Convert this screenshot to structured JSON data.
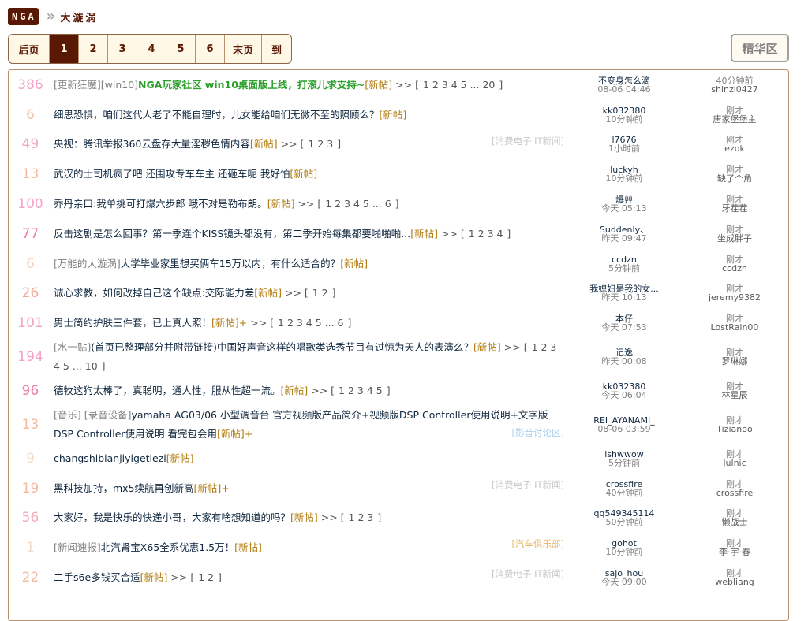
{
  "header": {
    "logo": "NGA",
    "separator": "»",
    "forum": "大漩涡"
  },
  "pager": {
    "prev": "后页",
    "pages": [
      "1",
      "2",
      "3",
      "4",
      "5",
      "6"
    ],
    "current": "1",
    "last": "末页",
    "goto": "到"
  },
  "elite_label": "精华区",
  "colors": {
    "brand": "#591804",
    "new": "#b0790a",
    "highlight": "#2a9f2a"
  },
  "topics": [
    {
      "count": "386",
      "count_color": "#f3a3c6",
      "prefix": "[更新狂魔][win10]",
      "highlight": "NGA玩家社区 win10桌面版上线，打滚儿求支持~",
      "title": "",
      "new": "[新帖]",
      "plus": "",
      "pages": "1 2 3 4 5 ... 20",
      "category": "",
      "cat_style": "",
      "author": "不变身怎么滴",
      "post_time": "08-06 04:46",
      "last_time": "40分钟前",
      "last_user": "shinzi0427",
      "tall": false
    },
    {
      "count": "6",
      "count_color": "#f0c5a8",
      "prefix": "",
      "highlight": "",
      "title": "细思恐惧，咱们这代人老了不能自理时，儿女能给咱们无微不至的照顾么？",
      "new": "[新帖]",
      "plus": "",
      "pages": "",
      "category": "",
      "cat_style": "",
      "author": "kk032380",
      "post_time": "10分钟前",
      "last_time": "刚才",
      "last_user": "唐家堡堡主",
      "tall": false
    },
    {
      "count": "49",
      "count_color": "#f5aab9",
      "prefix": "",
      "highlight": "",
      "title": "央视：腾讯举报360云盘存大量淫秽色情内容",
      "new": "[新帖]",
      "plus": "",
      "pages": "1 2 3",
      "category": "[消费电子 IT新闻]",
      "cat_style": "",
      "author": "l7676",
      "post_time": "1小时前",
      "last_time": "刚才",
      "last_user": "ezok",
      "tall": false
    },
    {
      "count": "13",
      "count_color": "#f5b9a0",
      "prefix": "",
      "highlight": "",
      "title": "武汉的士司机疯了吧 还围攻专车车主 还砸车呢 我好怕",
      "new": "[新帖]",
      "plus": "",
      "pages": "",
      "category": "",
      "cat_style": "",
      "author": "luckyh",
      "post_time": "10分钟前",
      "last_time": "刚才",
      "last_user": "缺了个角",
      "tall": false
    },
    {
      "count": "100",
      "count_color": "#f3a3c6",
      "prefix": "",
      "highlight": "",
      "title": "乔丹亲口:我单挑可打爆六步郎 哦不对是勒布朗。",
      "new": "[新帖]",
      "plus": "",
      "pages": "1 2 3 4 5 ... 6",
      "category": "",
      "cat_style": "",
      "author": "爆艸",
      "post_time": "今天 05:13",
      "last_time": "刚才",
      "last_user": "牙茬茬",
      "tall": false
    },
    {
      "count": "77",
      "count_color": "#ef7fa0",
      "prefix": "",
      "highlight": "",
      "title": "反击这剧是怎么回事？第一季连个KISS镜头都没有，第二季开始每集都要啪啪啪...",
      "new": "[新帖]",
      "plus": "",
      "pages": "1 2 3 4",
      "category": "",
      "cat_style": "",
      "author": "Suddenly、",
      "post_time": "昨天 09:47",
      "last_time": "刚才",
      "last_user": "坐成胖子",
      "tall": false
    },
    {
      "count": "6",
      "count_color": "#f5d5c0",
      "prefix": "[万能的大漩涡]",
      "highlight": "",
      "title": "大学毕业家里想买俩车15万以内，有什么适合的？",
      "new": "[新帖]",
      "plus": "",
      "pages": "",
      "category": "",
      "cat_style": "",
      "author": "ccdzn",
      "post_time": "5分钟前",
      "last_time": "刚才",
      "last_user": "ccdzn",
      "tall": false
    },
    {
      "count": "26",
      "count_color": "#f0a890",
      "prefix": "",
      "highlight": "",
      "title": "诚心求教，如何改掉自己这个缺点:交际能力差",
      "new": "[新帖]",
      "plus": "",
      "pages": "1 2",
      "category": "",
      "cat_style": "",
      "author": "我媳妇是我的女...",
      "post_time": "昨天 10:13",
      "last_time": "刚才",
      "last_user": "jeremy9382",
      "tall": false
    },
    {
      "count": "101",
      "count_color": "#f3a3c6",
      "prefix": "",
      "highlight": "",
      "title": "男士简约护肤三件套，已上真人照！",
      "new": "[新帖]",
      "plus": "+",
      "pages": "1 2 3 4 5 ... 6",
      "category": "",
      "cat_style": "",
      "author": "本仔",
      "post_time": "今天 07:53",
      "last_time": "刚才",
      "last_user": "LostRain00",
      "tall": false
    },
    {
      "count": "194",
      "count_color": "#f3a3c6",
      "prefix": "[水一贴]",
      "highlight": "",
      "title": "(首页已整理部分并附带链接)中国好声音这样的唱歌类选秀节目有过惊为天人的表演么？",
      "new": "[新帖]",
      "plus": "",
      "pages": "1 2 3 4 5 ... 10",
      "category": "",
      "cat_style": "",
      "author": "记逸",
      "post_time": "昨天 00:08",
      "last_time": "刚才",
      "last_user": "罗琳娜",
      "tall": true
    },
    {
      "count": "96",
      "count_color": "#ef7fa0",
      "prefix": "",
      "highlight": "",
      "title": "德牧这狗太棒了，真聪明，通人性，服从性超一流。",
      "new": "[新帖]",
      "plus": "",
      "pages": "1 2 3 4 5",
      "category": "",
      "cat_style": "",
      "author": "kk032380",
      "post_time": "今天 06:04",
      "last_time": "刚才",
      "last_user": "林星辰",
      "tall": false
    },
    {
      "count": "13",
      "count_color": "#f5b9a0",
      "prefix": "[音乐] [录音设备]",
      "highlight": "",
      "title": "yamaha AG03/06 小型调音台 官方视频版产品简介+视频版DSP Controller使用说明+文字版DSP Controller使用说明 看完包会用",
      "new": "[新帖]",
      "plus": "+",
      "pages": "",
      "category": "[影音讨论区]",
      "cat_style": "blue",
      "author": "REI_AYANAMI_",
      "post_time": "08-06 03:59",
      "last_time": "刚才",
      "last_user": "Tizianoo",
      "tall": true
    },
    {
      "count": "9",
      "count_color": "#f5dcc8",
      "prefix": "",
      "highlight": "",
      "title": "changshibianjiyigetiezi",
      "new": "[新帖]",
      "plus": "",
      "pages": "",
      "category": "",
      "cat_style": "",
      "author": "lshwwow",
      "post_time": "5分钟前",
      "last_time": "刚才",
      "last_user": "Julnic",
      "tall": false
    },
    {
      "count": "19",
      "count_color": "#f5b9a0",
      "prefix": "",
      "highlight": "",
      "title": "黑科技加持，mx5续航再创新高",
      "new": "[新帖]",
      "plus": "+",
      "pages": "",
      "category": "[消费电子 IT新闻]",
      "cat_style": "",
      "author": "crossfire",
      "post_time": "40分钟前",
      "last_time": "刚才",
      "last_user": "crossfire",
      "tall": false
    },
    {
      "count": "56",
      "count_color": "#f5aab9",
      "prefix": "",
      "highlight": "",
      "title": "大家好，我是快乐的快递小哥，大家有啥想知道的吗？",
      "new": "[新帖]",
      "plus": "",
      "pages": "1 2 3",
      "category": "",
      "cat_style": "",
      "author": "qq549345114",
      "post_time": "50分钟前",
      "last_time": "刚才",
      "last_user": "懒战士",
      "tall": false
    },
    {
      "count": "1",
      "count_color": "#f5dcc8",
      "prefix": "[新闻速报]",
      "highlight": "",
      "title": "北汽肾宝X65全系优惠1.5万！",
      "new": "[新帖]",
      "plus": "",
      "pages": "",
      "category": "[汽车俱乐部]",
      "cat_style": "orange",
      "author": "gohot",
      "post_time": "10分钟前",
      "last_time": "刚才",
      "last_user": "李·宇·春",
      "tall": false
    },
    {
      "count": "22",
      "count_color": "#f5b9a0",
      "prefix": "",
      "highlight": "",
      "title": "二手s6e多钱买合适",
      "new": "[新帖]",
      "plus": "",
      "pages": "1 2",
      "category": "[消费电子 IT新闻]",
      "cat_style": "",
      "author": "sajo_hou",
      "post_time": "今天 09:00",
      "last_time": "刚才",
      "last_user": "webliang",
      "tall": false
    }
  ]
}
